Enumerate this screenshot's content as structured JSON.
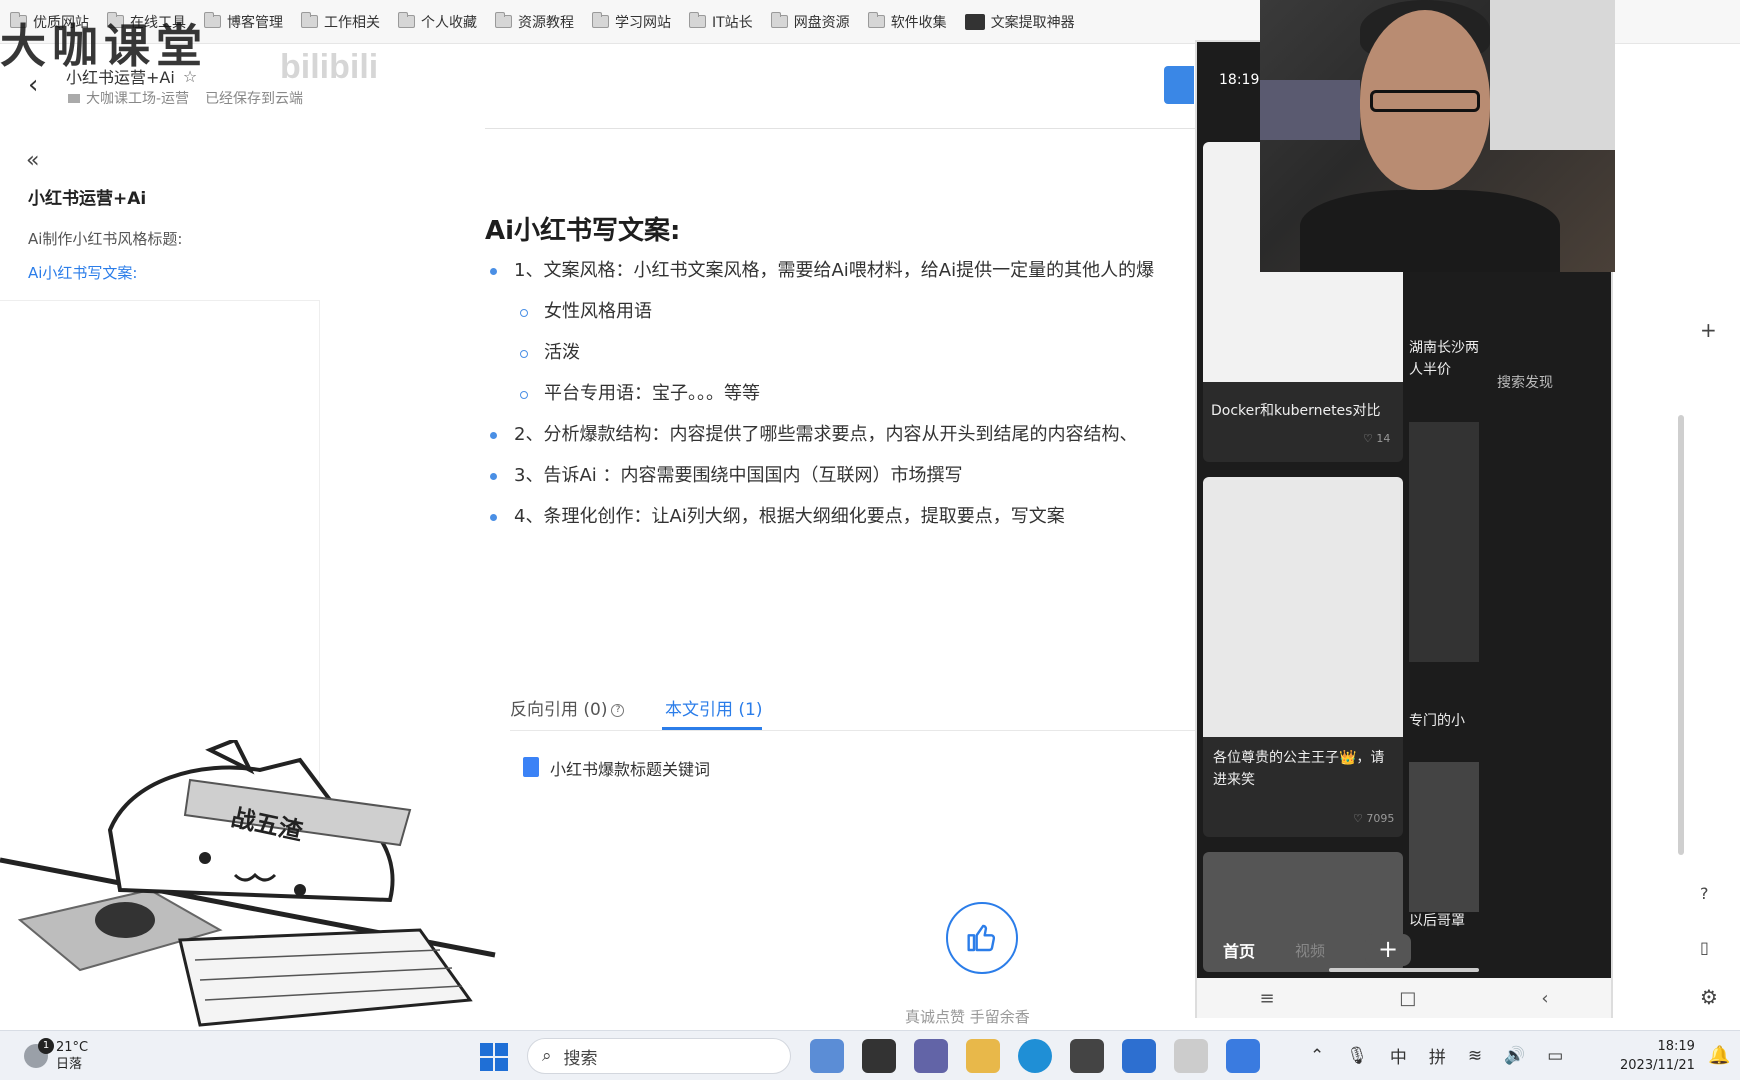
{
  "bookmarks": [
    {
      "label": "优质网站",
      "icon": "folder-icon"
    },
    {
      "label": "在线工具",
      "icon": "folder-icon"
    },
    {
      "label": "博客管理",
      "icon": "folder-icon"
    },
    {
      "label": "工作相关",
      "icon": "folder-icon"
    },
    {
      "label": "个人收藏",
      "icon": "folder-icon"
    },
    {
      "label": "资源教程",
      "icon": "folder-icon"
    },
    {
      "label": "学习网站",
      "icon": "folder-icon"
    },
    {
      "label": "IT站长",
      "icon": "folder-icon"
    },
    {
      "label": "网盘资源",
      "icon": "folder-icon"
    },
    {
      "label": "软件收集",
      "icon": "folder-icon"
    },
    {
      "label": "文案提取神器",
      "icon": "app-logo-icon"
    }
  ],
  "watermark": {
    "text": "大咖课堂",
    "bili": "bilibili"
  },
  "doc": {
    "title": "小红书运营+Ai",
    "workspace": "大咖课工场-运营",
    "save_status": "已经保存到云端"
  },
  "sidebar": {
    "title": "小红书运营+Ai",
    "items": [
      {
        "label": "Ai制作小红书风格标题:",
        "active": false
      },
      {
        "label": "Ai小红书写文案:",
        "active": true
      }
    ]
  },
  "content": {
    "heading": "Ai小红书写文案:",
    "item1": "1、文案风格：小红书文案风格，需要给Ai喂材料，给Ai提供一定量的其他人的爆",
    "sub1": "女性风格用语",
    "sub2": "活泼",
    "sub3": "平台专用语：宝子。。。等等",
    "item2": "2、分析爆款结构：内容提供了哪些需求要点，内容从开头到结尾的内容结构、",
    "item3": "3、告诉Ai ：内容需要围绕中国国内（互联网）市场撰写",
    "item4": "4、条理化创作：让Ai列大纲，根据大纲细化要点，提取要点，写文案"
  },
  "tabs": {
    "backlinks": "反向引用 (0)",
    "references": "本文引用 (1)"
  },
  "reference_item": "小红书爆款标题关键词",
  "like_text": "真诚点赞   手留余香",
  "cat_band": "战五渣",
  "phone": {
    "time": "18:19",
    "card1_title": "Docker和kubernetes对比",
    "card1_likes": "14",
    "card2_title": "各位尊贵的公主王子👑，请进来笑",
    "card2_likes": "7095",
    "col2_text1": "湖南长沙两人半价",
    "col2_text2": "专门的小",
    "col2_text3": "以后哥罩",
    "right_text": "搜索发现",
    "nav_home": "首页",
    "nav_video": "视频",
    "nav_plus": "+"
  },
  "taskbar": {
    "temperature": "21°C",
    "weather": "日落",
    "weather_badge": "1",
    "search_label": "搜索",
    "tray_lang1": "中",
    "tray_lang2": "拼",
    "time": "18:19",
    "date": "2023/11/21"
  }
}
